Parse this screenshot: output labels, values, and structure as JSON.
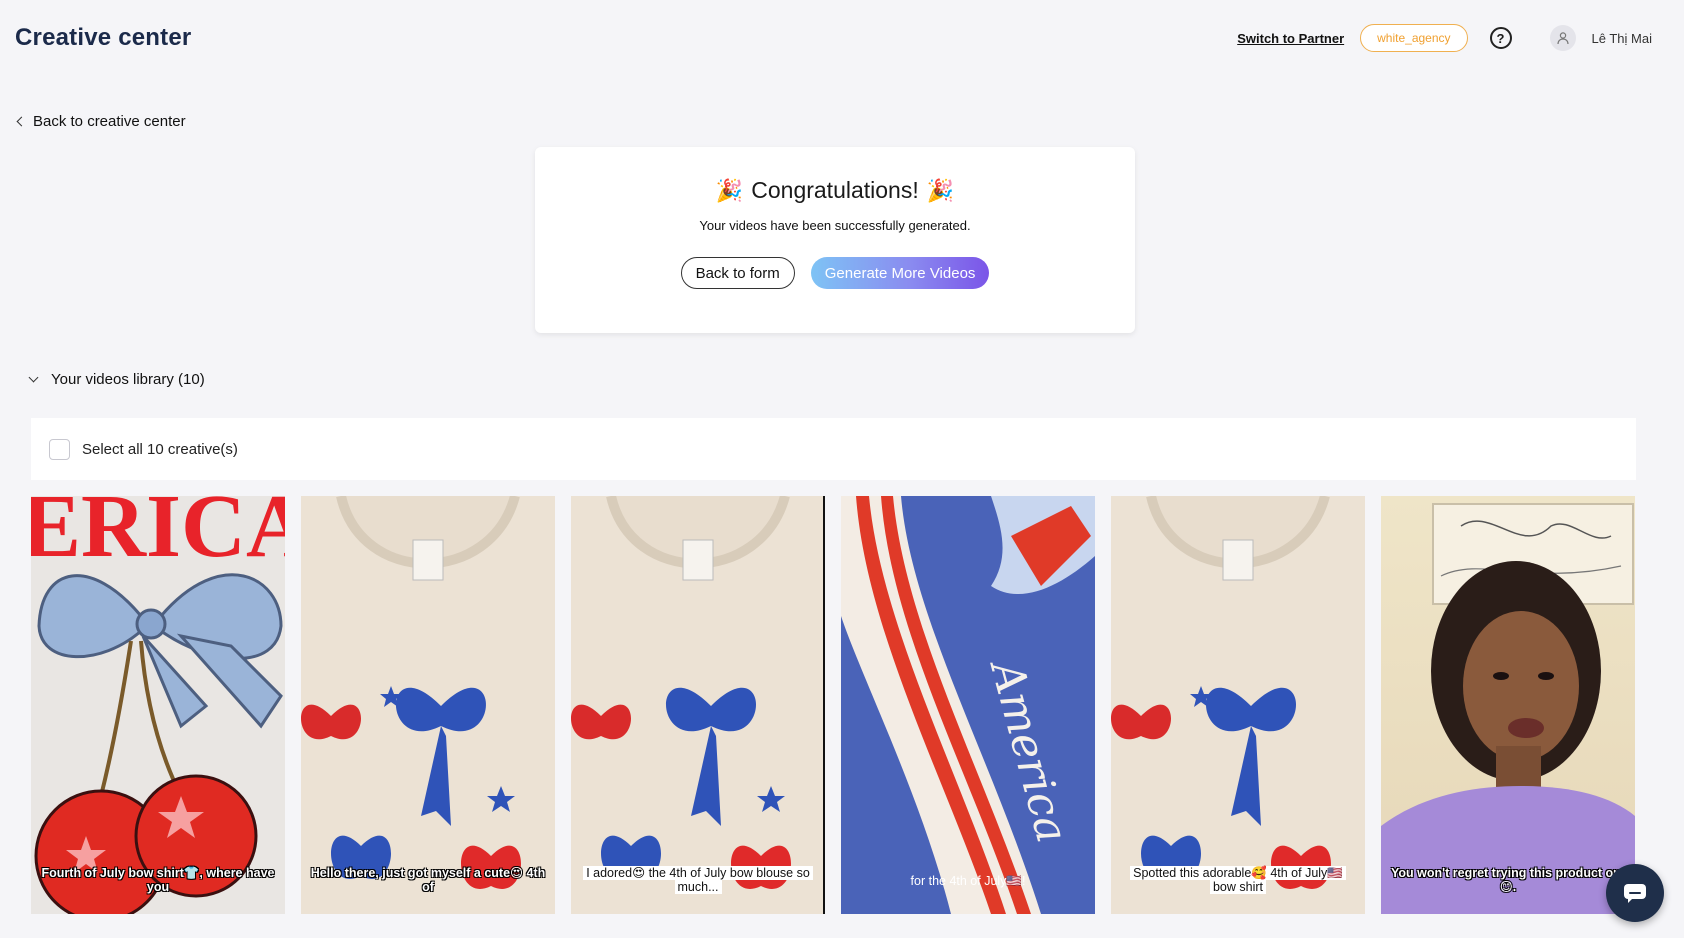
{
  "header": {
    "title": "Creative center",
    "switch_link": "Switch to Partner",
    "agency_badge": "white_agency",
    "help_glyph": "?",
    "user_name": "Lê Thị Mai"
  },
  "nav": {
    "back_link": "Back to creative center"
  },
  "congrats": {
    "title": "Congratulations!",
    "party_emoji": "🎉",
    "message": "Your videos have been successfully generated.",
    "back_button": "Back to form",
    "generate_button": "Generate More Videos"
  },
  "library": {
    "heading": "Your videos library (10)",
    "select_all_label": "Select all 10 creative(s)",
    "videos": [
      {
        "caption": "Fourth of July bow shirt👕, where have you"
      },
      {
        "caption": "Hello there, just got myself a cute😍 4th of"
      },
      {
        "caption": "I adored😍 the 4th of July bow blouse so much..."
      },
      {
        "caption": "for the 4th of July🇺🇸!"
      },
      {
        "caption": "Spotted this adorable🥰 4th of July🇺🇸 bow shirt"
      },
      {
        "caption": "You won't regret trying this product out😊."
      }
    ]
  },
  "colors": {
    "accent_gradient_start": "#7ec3f5",
    "accent_gradient_end": "#7b55e8",
    "badge_orange": "#f0a030",
    "chat_button_bg": "#1f2f4a"
  }
}
